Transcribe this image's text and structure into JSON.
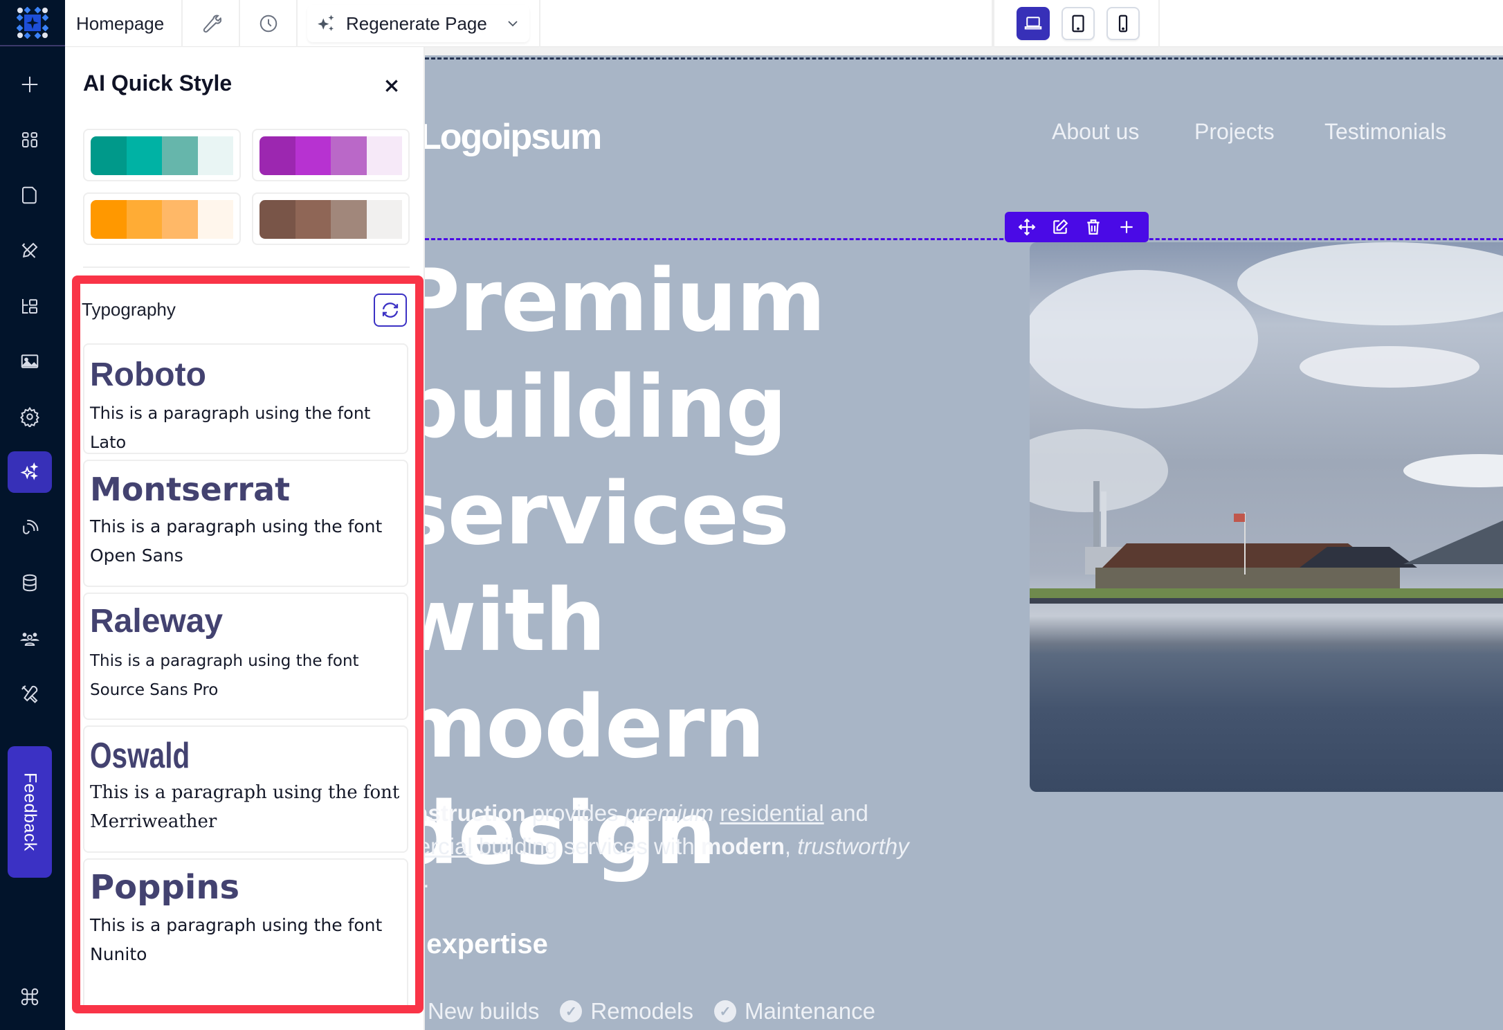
{
  "app": {
    "page_name": "Homepage",
    "regenerate_label": "Regenerate Page"
  },
  "rail": {
    "items": [
      {
        "icon": "plus-icon",
        "label": "Add"
      },
      {
        "icon": "grid-icon",
        "label": "Sections"
      },
      {
        "icon": "page-icon",
        "label": "Pages"
      },
      {
        "icon": "design-icon",
        "label": "Design"
      },
      {
        "icon": "tree-icon",
        "label": "Layers"
      },
      {
        "icon": "image-icon",
        "label": "Media"
      },
      {
        "icon": "gear-icon",
        "label": "Settings"
      },
      {
        "icon": "sparkle-icon",
        "label": "AI Quick Style",
        "active": true
      },
      {
        "icon": "broadcast-icon",
        "label": "Publish"
      },
      {
        "icon": "database-icon",
        "label": "Data"
      },
      {
        "icon": "users-icon",
        "label": "Team"
      },
      {
        "icon": "tools-icon",
        "label": "Tools"
      }
    ],
    "feedback_label": "Feedback",
    "command_icon": "command-icon"
  },
  "devices": [
    {
      "name": "desktop",
      "active": true
    },
    {
      "name": "tablet",
      "active": false
    },
    {
      "name": "mobile",
      "active": false
    }
  ],
  "panel": {
    "title": "AI Quick Style",
    "palettes": [
      {
        "colors": [
          "#00998a",
          "#00b2a4",
          "#66b6ab",
          "#e9f5f4"
        ]
      },
      {
        "colors": [
          "#9c27b0",
          "#b732d1",
          "#ba68c8",
          "#f6e9f8"
        ]
      },
      {
        "colors": [
          "#ff9800",
          "#ffac35",
          "#ffb867",
          "#fff6ec"
        ]
      },
      {
        "colors": [
          "#795548",
          "#8f6656",
          "#a1877b",
          "#f1f0ef"
        ]
      }
    ],
    "typography": {
      "label": "Typography",
      "fonts": [
        {
          "heading": "Roboto",
          "paragraph": "This is a paragraph using the font Lato"
        },
        {
          "heading": "Montserrat",
          "paragraph": "This is a paragraph using the font Open Sans"
        },
        {
          "heading": "Raleway",
          "paragraph": "This is a paragraph using the font Source Sans Pro"
        },
        {
          "heading": "Oswald",
          "paragraph": "This is a paragraph using the font Merriweather"
        },
        {
          "heading": "Poppins",
          "paragraph": "This is a paragraph using the font Nunito"
        }
      ]
    }
  },
  "site": {
    "logo": "Logoipsum",
    "nav": [
      "About us",
      "Projects",
      "Testimonials"
    ],
    "headline_lines": [
      "Premium",
      "building",
      "services with",
      "modern",
      "design"
    ],
    "intro": {
      "brand": "W Construction",
      "t1": " provides ",
      "em1": "premium",
      "t2": " ",
      "u1": "residential",
      "t3": " and ",
      "u2": "commercial",
      "t4": " building services with ",
      "b2": "modern",
      "t5": ", ",
      "em2": "trustworthy",
      "t6": " design."
    },
    "expertise_title": "Our expertise",
    "expertise": [
      "New builds",
      "Remodels",
      "Maintenance"
    ],
    "accent": "#4a0ae6"
  }
}
